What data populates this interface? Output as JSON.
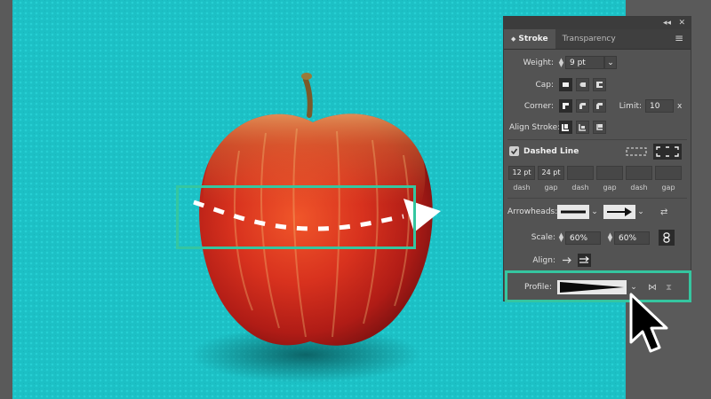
{
  "window": {
    "collapse_icon": "double-chevron-icon",
    "close_icon": "close-icon"
  },
  "tabs": [
    {
      "label": "Stroke",
      "active": true
    },
    {
      "label": "Transparency",
      "active": false
    }
  ],
  "weight": {
    "label": "Weight:",
    "value": "9 pt"
  },
  "cap": {
    "label": "Cap:"
  },
  "corner": {
    "label": "Corner:",
    "limit_label": "Limit:",
    "limit_value": "10",
    "limit_suffix": "x"
  },
  "align_stroke": {
    "label": "Align Stroke:"
  },
  "dashed_line": {
    "label": "Dashed Line",
    "checked": true
  },
  "dashes": [
    {
      "value": "12 pt",
      "label": "dash"
    },
    {
      "value": "24 pt",
      "label": "gap"
    },
    {
      "value": "",
      "label": "dash"
    },
    {
      "value": "",
      "label": "gap"
    },
    {
      "value": "",
      "label": "dash"
    },
    {
      "value": "",
      "label": "gap"
    }
  ],
  "arrowheads": {
    "label": "Arrowheads:"
  },
  "scale": {
    "label": "Scale:",
    "start": "60%",
    "end": "60%"
  },
  "align": {
    "label": "Align:"
  },
  "profile": {
    "label": "Profile:"
  },
  "colors": {
    "background": "#1abfc4",
    "highlight": "#35c6a0",
    "panel": "#535353"
  }
}
